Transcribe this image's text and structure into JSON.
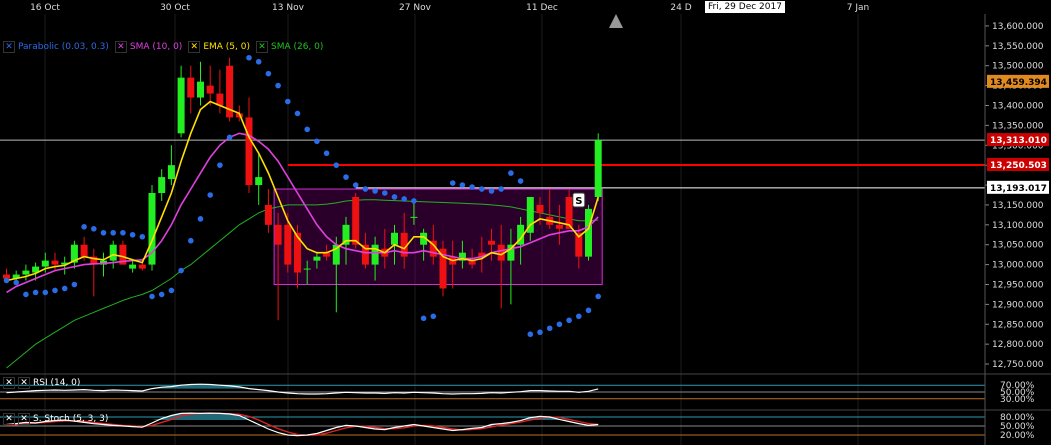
{
  "x_axis": {
    "labels": [
      "16 Oct",
      "30 Oct",
      "13 Nov",
      "27 Nov",
      "11 Dec",
      "24 D",
      "7 Jan"
    ],
    "crosshair_date": "Fri, 29 Dec 2017"
  },
  "legend": {
    "main": [
      {
        "label": "Parabolic (0.03, 0.3)",
        "color": "#2a6be6"
      },
      {
        "label": "SMA (10, 0)",
        "color": "#e040e0"
      },
      {
        "label": "EMA (5, 0)",
        "color": "#ffe000"
      },
      {
        "label": "SMA (26, 0)",
        "color": "#22c022"
      }
    ],
    "rsi": "RSI (14, 0)",
    "stoch": "S. Stoch (5, 3, 3)"
  },
  "price_axis": {
    "ticks": [
      "13,600.000",
      "13,550.000",
      "13,500.000",
      "13,450.000",
      "13,400.000",
      "13,350.000",
      "13,300.000",
      "13,250.000",
      "13,200.000",
      "13,150.000",
      "13,100.000",
      "13,050.000",
      "13,000.000",
      "12,950.000",
      "12,900.000",
      "12,850.000",
      "12,800.000",
      "12,750.000"
    ],
    "ylim": [
      12730,
      13630
    ],
    "tags": [
      {
        "price": 13459.394,
        "label": "13,459.394",
        "bg": "#e08a20",
        "fg": "#000000"
      },
      {
        "price": 13313.01,
        "label": "13,313.010",
        "bg": "#cc0000",
        "fg": "#ffffff"
      },
      {
        "price": 13250.503,
        "label": "13,250.503",
        "bg": "#cc0000",
        "fg": "#ffffff"
      },
      {
        "price": 13193.017,
        "label": "13,193.017",
        "bg": "#ffffff",
        "fg": "#000000"
      }
    ]
  },
  "rsi_axis": {
    "ticks": [
      "70.00%",
      "50.00%",
      "30.00%"
    ]
  },
  "stoch_axis": {
    "ticks": [
      "80.00%",
      "50.00%",
      "20.00%"
    ]
  },
  "signal_label": "S",
  "chart_data": {
    "type": "candlestick",
    "series_candles": [
      {
        "o": 12975,
        "h": 12990,
        "l": 12955,
        "c": 12965
      },
      {
        "o": 12965,
        "h": 12985,
        "l": 12955,
        "c": 12975
      },
      {
        "o": 12975,
        "h": 13000,
        "l": 12960,
        "c": 12985
      },
      {
        "o": 12980,
        "h": 13005,
        "l": 12960,
        "c": 12995
      },
      {
        "o": 12995,
        "h": 13030,
        "l": 12980,
        "c": 13010
      },
      {
        "o": 13010,
        "h": 13030,
        "l": 12985,
        "c": 13000
      },
      {
        "o": 13000,
        "h": 13020,
        "l": 12975,
        "c": 13005
      },
      {
        "o": 13005,
        "h": 13060,
        "l": 12990,
        "c": 13050
      },
      {
        "o": 13050,
        "h": 13070,
        "l": 13010,
        "c": 13020
      },
      {
        "o": 13020,
        "h": 13040,
        "l": 12920,
        "c": 13000
      },
      {
        "o": 13000,
        "h": 13030,
        "l": 12970,
        "c": 13010
      },
      {
        "o": 13010,
        "h": 13060,
        "l": 12990,
        "c": 13050
      },
      {
        "o": 13050,
        "h": 13060,
        "l": 13000,
        "c": 13000
      },
      {
        "o": 12990,
        "h": 13010,
        "l": 12980,
        "c": 13000
      },
      {
        "o": 13000,
        "h": 13005,
        "l": 12985,
        "c": 12990
      },
      {
        "o": 13000,
        "h": 13200,
        "l": 12985,
        "c": 13180
      },
      {
        "o": 13180,
        "h": 13240,
        "l": 13160,
        "c": 13220
      },
      {
        "o": 13215,
        "h": 13300,
        "l": 13200,
        "c": 13250
      },
      {
        "o": 13330,
        "h": 13500,
        "l": 13320,
        "c": 13470
      },
      {
        "o": 13470,
        "h": 13500,
        "l": 13380,
        "c": 13420
      },
      {
        "o": 13420,
        "h": 13510,
        "l": 13400,
        "c": 13460
      },
      {
        "o": 13450,
        "h": 13500,
        "l": 13400,
        "c": 13430
      },
      {
        "o": 13430,
        "h": 13490,
        "l": 13380,
        "c": 13400
      },
      {
        "o": 13500,
        "h": 13520,
        "l": 13360,
        "c": 13370
      },
      {
        "o": 13380,
        "h": 13400,
        "l": 13360,
        "c": 13370
      },
      {
        "o": 13370,
        "h": 13420,
        "l": 13180,
        "c": 13200
      },
      {
        "o": 13200,
        "h": 13280,
        "l": 13150,
        "c": 13220
      },
      {
        "o": 13150,
        "h": 13190,
        "l": 13080,
        "c": 13100
      },
      {
        "o": 13100,
        "h": 13130,
        "l": 12860,
        "c": 13050
      },
      {
        "o": 13100,
        "h": 13130,
        "l": 12980,
        "c": 13000
      },
      {
        "o": 13080,
        "h": 13100,
        "l": 12940,
        "c": 12980
      },
      {
        "o": 12990,
        "h": 13010,
        "l": 12950,
        "c": 12990
      },
      {
        "o": 13010,
        "h": 13030,
        "l": 12990,
        "c": 13020
      },
      {
        "o": 13030,
        "h": 13050,
        "l": 13010,
        "c": 13020
      },
      {
        "o": 13000,
        "h": 13070,
        "l": 12880,
        "c": 13050
      },
      {
        "o": 13050,
        "h": 13120,
        "l": 13000,
        "c": 13100
      },
      {
        "o": 13170,
        "h": 13180,
        "l": 13040,
        "c": 13050
      },
      {
        "o": 13050,
        "h": 13080,
        "l": 12990,
        "c": 13000
      },
      {
        "o": 13000,
        "h": 13070,
        "l": 12960,
        "c": 13050
      },
      {
        "o": 13040,
        "h": 13090,
        "l": 12990,
        "c": 13020
      },
      {
        "o": 13050,
        "h": 13100,
        "l": 13000,
        "c": 13080
      },
      {
        "o": 13080,
        "h": 13130,
        "l": 12990,
        "c": 13020
      },
      {
        "o": 13120,
        "h": 13160,
        "l": 13100,
        "c": 13120
      },
      {
        "o": 13050,
        "h": 13090,
        "l": 13010,
        "c": 13080
      },
      {
        "o": 13060,
        "h": 13100,
        "l": 13000,
        "c": 13020
      },
      {
        "o": 13040,
        "h": 13060,
        "l": 12920,
        "c": 12940
      },
      {
        "o": 13020,
        "h": 13060,
        "l": 12940,
        "c": 13000
      },
      {
        "o": 13010,
        "h": 13060,
        "l": 12990,
        "c": 13030
      },
      {
        "o": 13010,
        "h": 13040,
        "l": 12990,
        "c": 13000
      },
      {
        "o": 13030,
        "h": 13070,
        "l": 12980,
        "c": 13020
      },
      {
        "o": 13060,
        "h": 13090,
        "l": 13010,
        "c": 13050
      },
      {
        "o": 13050,
        "h": 13100,
        "l": 12890,
        "c": 13010
      },
      {
        "o": 13010,
        "h": 13090,
        "l": 12900,
        "c": 13050
      },
      {
        "o": 13050,
        "h": 13120,
        "l": 13000,
        "c": 13100
      },
      {
        "o": 13080,
        "h": 13170,
        "l": 13060,
        "c": 13170
      },
      {
        "o": 13150,
        "h": 13170,
        "l": 13100,
        "c": 13130
      },
      {
        "o": 13120,
        "h": 13190,
        "l": 13090,
        "c": 13100
      },
      {
        "o": 13100,
        "h": 13150,
        "l": 13050,
        "c": 13090
      },
      {
        "o": 13170,
        "h": 13190,
        "l": 13090,
        "c": 13090
      },
      {
        "o": 13080,
        "h": 13100,
        "l": 12990,
        "c": 13020
      },
      {
        "o": 13020,
        "h": 13150,
        "l": 13010,
        "c": 13140
      },
      {
        "o": 13170,
        "h": 13330,
        "l": 13160,
        "c": 13313
      }
    ],
    "sma26": [
      12740,
      12760,
      12780,
      12800,
      12815,
      12830,
      12845,
      12860,
      12870,
      12880,
      12890,
      12900,
      12910,
      12918,
      12925,
      12935,
      12950,
      12965,
      12985,
      13000,
      13020,
      13040,
      13060,
      13080,
      13100,
      13115,
      13130,
      13140,
      13145,
      13150,
      13150,
      13150,
      13150,
      13152,
      13155,
      13160,
      13162,
      13163,
      13163,
      13162,
      13161,
      13160,
      13159,
      13158,
      13157,
      13156,
      13155,
      13154,
      13153,
      13152,
      13150,
      13148,
      13145,
      13140,
      13135,
      13130,
      13125,
      13120,
      13115,
      13110,
      13110,
      13112
    ],
    "sma10": [
      12930,
      12945,
      12955,
      12965,
      12975,
      12985,
      12990,
      12995,
      13000,
      13002,
      13003,
      13005,
      13008,
      13010,
      13012,
      13030,
      13060,
      13100,
      13150,
      13190,
      13230,
      13270,
      13300,
      13320,
      13330,
      13325,
      13310,
      13290,
      13260,
      13220,
      13180,
      13140,
      13100,
      13070,
      13050,
      13040,
      13035,
      13030,
      13030,
      13030,
      13035,
      13030,
      13030,
      13035,
      13030,
      13025,
      13020,
      13015,
      13015,
      13020,
      13030,
      13035,
      13040,
      13045,
      13055,
      13065,
      13075,
      13080,
      13085,
      13085,
      13095,
      13120
    ],
    "ema5": [
      12960,
      12965,
      12970,
      12978,
      12990,
      12995,
      12998,
      13010,
      13020,
      13015,
      13012,
      13025,
      13020,
      13012,
      13005,
      13060,
      13120,
      13180,
      13260,
      13330,
      13390,
      13410,
      13400,
      13390,
      13380,
      13320,
      13280,
      13230,
      13170,
      13110,
      13070,
      13040,
      13030,
      13030,
      13040,
      13060,
      13060,
      13040,
      13040,
      13030,
      13050,
      13040,
      13070,
      13070,
      13050,
      13020,
      13010,
      13015,
      13010,
      13015,
      13030,
      13025,
      13040,
      13065,
      13100,
      13115,
      13110,
      13105,
      13100,
      13070,
      13090,
      13170
    ],
    "psar": [
      {
        "i": 0,
        "v": 12960
      },
      {
        "i": 1,
        "v": 12955
      },
      {
        "i": 2,
        "v": 12925
      },
      {
        "i": 3,
        "v": 12930
      },
      {
        "i": 4,
        "v": 12930
      },
      {
        "i": 5,
        "v": 12935
      },
      {
        "i": 6,
        "v": 12940
      },
      {
        "i": 7,
        "v": 12950
      },
      {
        "i": 8,
        "v": 13095
      },
      {
        "i": 9,
        "v": 13090
      },
      {
        "i": 10,
        "v": 13080
      },
      {
        "i": 11,
        "v": 13080
      },
      {
        "i": 12,
        "v": 13080
      },
      {
        "i": 13,
        "v": 13075
      },
      {
        "i": 14,
        "v": 13070
      },
      {
        "i": 15,
        "v": 12920
      },
      {
        "i": 16,
        "v": 12925
      },
      {
        "i": 17,
        "v": 12935
      },
      {
        "i": 18,
        "v": 12985
      },
      {
        "i": 19,
        "v": 13060
      },
      {
        "i": 20,
        "v": 13115
      },
      {
        "i": 21,
        "v": 13175
      },
      {
        "i": 22,
        "v": 13250
      },
      {
        "i": 23,
        "v": 13320
      },
      {
        "i": 25,
        "v": 13520
      },
      {
        "i": 26,
        "v": 13510
      },
      {
        "i": 27,
        "v": 13480
      },
      {
        "i": 28,
        "v": 13450
      },
      {
        "i": 29,
        "v": 13410
      },
      {
        "i": 30,
        "v": 13380
      },
      {
        "i": 31,
        "v": 13340
      },
      {
        "i": 32,
        "v": 13310
      },
      {
        "i": 33,
        "v": 13280
      },
      {
        "i": 34,
        "v": 13250
      },
      {
        "i": 35,
        "v": 13220
      },
      {
        "i": 36,
        "v": 13200
      },
      {
        "i": 37,
        "v": 13190
      },
      {
        "i": 38,
        "v": 13185
      },
      {
        "i": 39,
        "v": 13180
      },
      {
        "i": 40,
        "v": 13170
      },
      {
        "i": 41,
        "v": 13165
      },
      {
        "i": 42,
        "v": 13160
      },
      {
        "i": 43,
        "v": 12865
      },
      {
        "i": 44,
        "v": 12870
      },
      {
        "i": 46,
        "v": 13205
      },
      {
        "i": 47,
        "v": 13200
      },
      {
        "i": 48,
        "v": 13195
      },
      {
        "i": 49,
        "v": 13190
      },
      {
        "i": 50,
        "v": 13185
      },
      {
        "i": 51,
        "v": 13190
      },
      {
        "i": 52,
        "v": 13230
      },
      {
        "i": 53,
        "v": 13210
      },
      {
        "i": 54,
        "v": 12825
      },
      {
        "i": 55,
        "v": 12830
      },
      {
        "i": 56,
        "v": 12840
      },
      {
        "i": 57,
        "v": 12850
      },
      {
        "i": 58,
        "v": 12860
      },
      {
        "i": 59,
        "v": 12870
      },
      {
        "i": 60,
        "v": 12885
      },
      {
        "i": 61,
        "v": 12920
      }
    ],
    "box": {
      "from": 28,
      "to": 61,
      "high": 13190,
      "low": 12950
    },
    "resistance": {
      "value": 13250.503,
      "from": 29,
      "to": 999
    },
    "support": {
      "value": 13193.017,
      "from": 36,
      "to": 999
    },
    "last_price_line": 13313.01,
    "signal_index": 59,
    "rsi": {
      "levels": [
        70,
        50,
        30
      ],
      "values": [
        48,
        50,
        52,
        54,
        55,
        56,
        55,
        56,
        57,
        55,
        54,
        56,
        55,
        54,
        53,
        60,
        64,
        66,
        70,
        72,
        73,
        72,
        70,
        68,
        65,
        60,
        57,
        54,
        50,
        47,
        45,
        44,
        44,
        45,
        47,
        49,
        48,
        47,
        47,
        46,
        48,
        47,
        49,
        48,
        47,
        45,
        44,
        45,
        45,
        46,
        48,
        47,
        49,
        51,
        54,
        54,
        53,
        52,
        52,
        49,
        52,
        59
      ]
    },
    "stoch": {
      "levels": [
        80,
        50,
        20
      ],
      "k": [
        55,
        58,
        62,
        60,
        65,
        68,
        70,
        66,
        62,
        58,
        55,
        52,
        50,
        48,
        46,
        60,
        75,
        85,
        92,
        93,
        92,
        93,
        92,
        90,
        85,
        70,
        55,
        40,
        28,
        20,
        18,
        20,
        25,
        35,
        45,
        52,
        50,
        45,
        40,
        38,
        45,
        50,
        55,
        50,
        45,
        40,
        35,
        38,
        42,
        45,
        55,
        58,
        62,
        68,
        78,
        82,
        80,
        72,
        65,
        58,
        52,
        55
      ],
      "d": [
        52,
        54,
        58,
        60,
        62,
        65,
        67,
        68,
        66,
        62,
        58,
        55,
        52,
        50,
        48,
        52,
        62,
        72,
        84,
        90,
        92,
        92,
        92,
        91,
        89,
        82,
        70,
        55,
        41,
        30,
        22,
        19,
        20,
        26,
        35,
        44,
        49,
        49,
        45,
        41,
        41,
        44,
        50,
        52,
        50,
        45,
        40,
        37,
        38,
        41,
        47,
        53,
        58,
        63,
        70,
        76,
        80,
        78,
        72,
        65,
        58,
        55
      ]
    }
  }
}
